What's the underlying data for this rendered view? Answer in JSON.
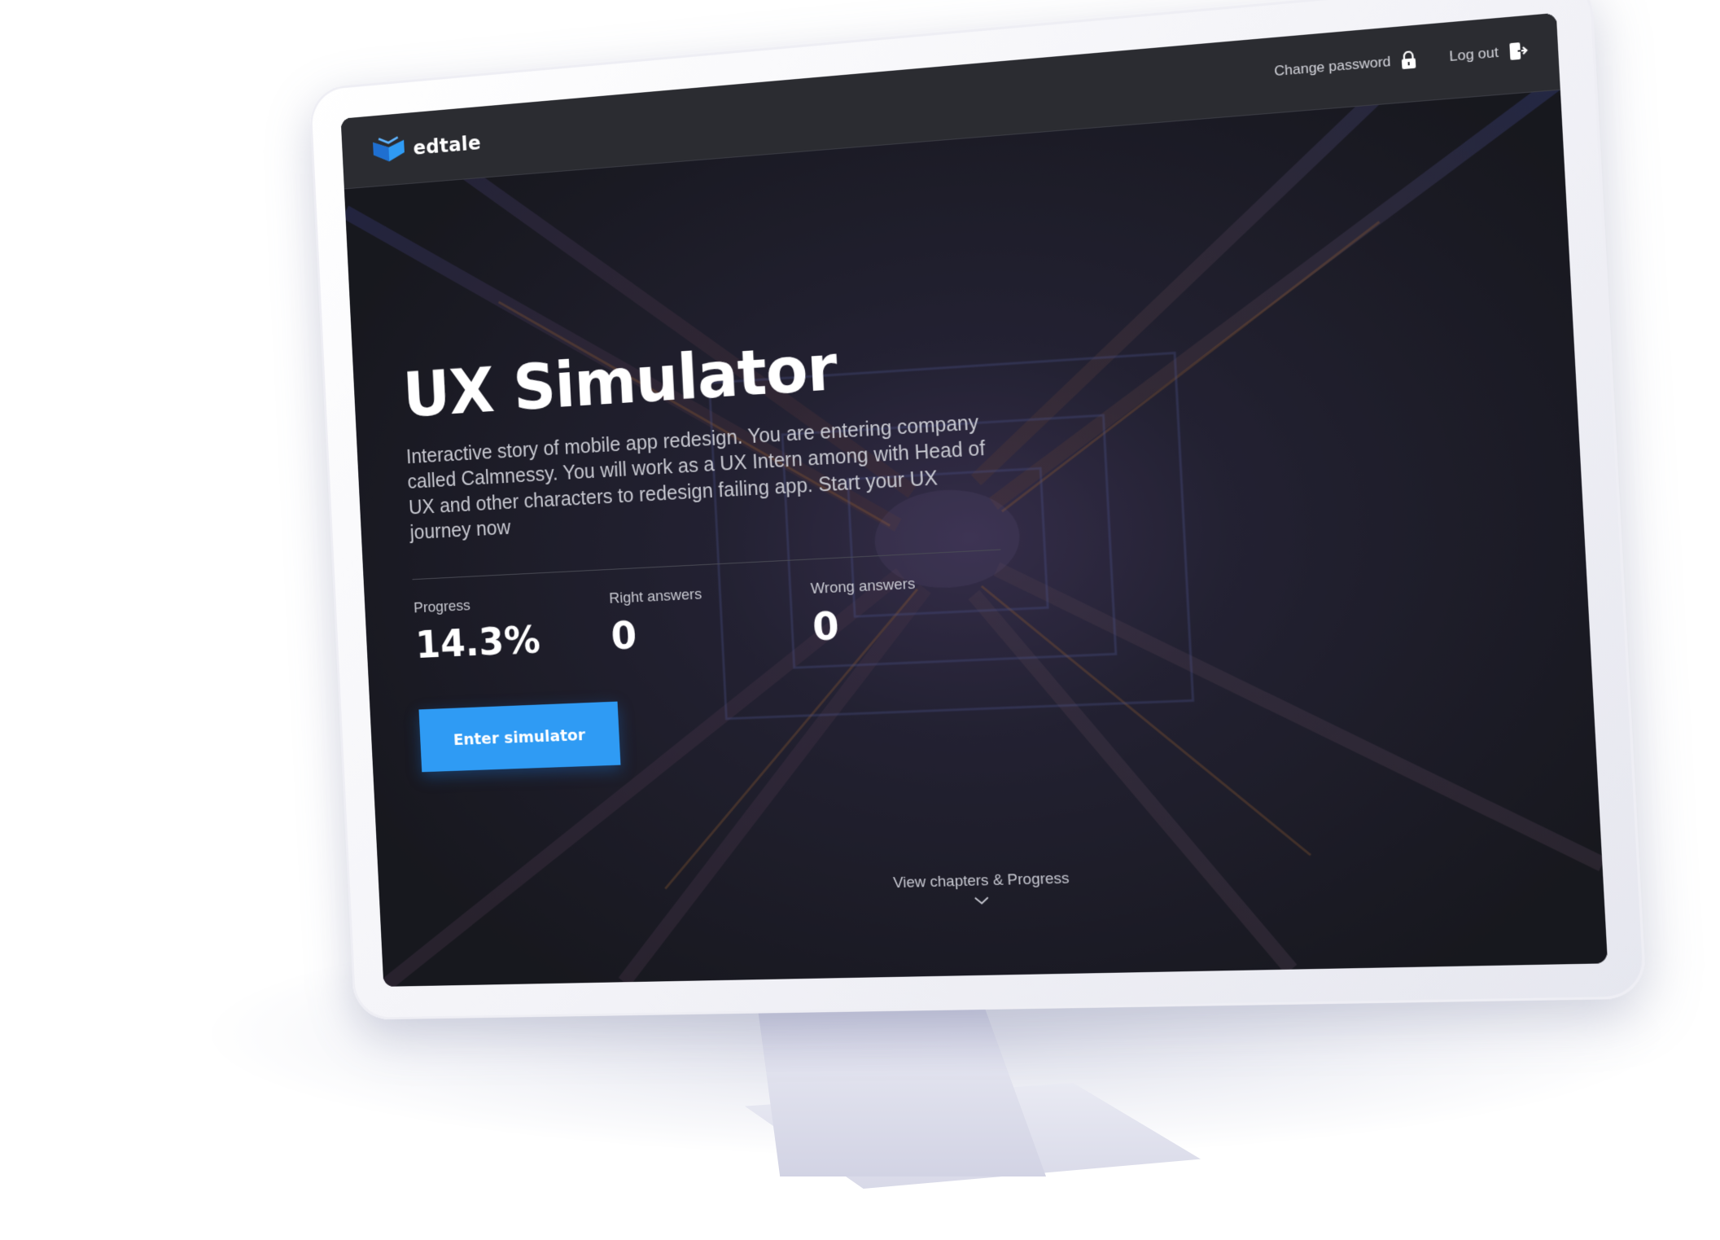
{
  "brand": {
    "name": "edtale",
    "accent": "#2f9bf4"
  },
  "header": {
    "change_password": {
      "label": "Change password",
      "icon": "lock-icon"
    },
    "log_out": {
      "label": "Log out",
      "icon": "logout-icon"
    }
  },
  "hero": {
    "title": "UX Simulator",
    "description": "Interactive story of mobile app redesign. You are entering company called Calmnessy. You will work as a UX Intern among with Head of UX and other characters to redesign failing app. Start your UX journey now"
  },
  "stats": [
    {
      "label": "Progress",
      "value": "14.3%"
    },
    {
      "label": "Right answers",
      "value": "0"
    },
    {
      "label": "Wrong answers",
      "value": "0"
    }
  ],
  "cta": {
    "label": "Enter simulator"
  },
  "footer_link": {
    "label": "View chapters & Progress",
    "icon": "chevron-down-icon"
  }
}
